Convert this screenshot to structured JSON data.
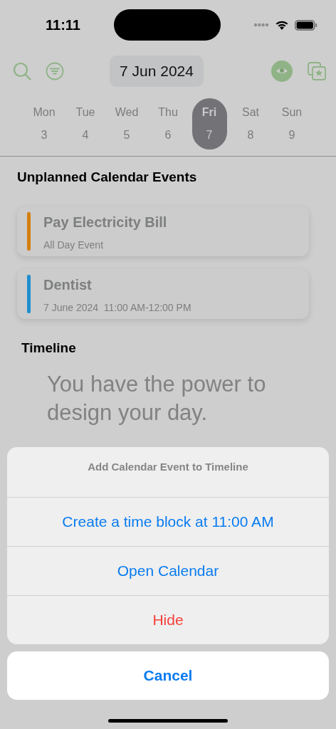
{
  "status_bar": {
    "time": "11:11"
  },
  "toolbar": {
    "date": "7 Jun 2024"
  },
  "week": [
    {
      "day": "Mon",
      "date": "3",
      "selected": false
    },
    {
      "day": "Tue",
      "date": "4",
      "selected": false
    },
    {
      "day": "Wed",
      "date": "5",
      "selected": false
    },
    {
      "day": "Thu",
      "date": "6",
      "selected": false
    },
    {
      "day": "Fri",
      "date": "7",
      "selected": true
    },
    {
      "day": "Sat",
      "date": "8",
      "selected": false
    },
    {
      "day": "Sun",
      "date": "9",
      "selected": false
    }
  ],
  "unplanned": {
    "title": "Unplanned Calendar Events",
    "events": [
      {
        "title": "Pay Electricity Bill",
        "detail": "All Day Event",
        "color": "#d57f0e"
      },
      {
        "title": "Dentist",
        "detail": "7 June 2024  11:00 AM-12:00 PM",
        "color": "#1e8fd0"
      }
    ]
  },
  "timeline": {
    "title": "Timeline",
    "message": "You have the power to design your day."
  },
  "action_sheet": {
    "title": "Add Calendar Event to Timeline",
    "actions": [
      {
        "label": "Create a time block at 11:00 AM",
        "kind": "default"
      },
      {
        "label": "Open Calendar",
        "kind": "default"
      },
      {
        "label": "Hide",
        "kind": "destructive"
      }
    ],
    "cancel": "Cancel"
  }
}
